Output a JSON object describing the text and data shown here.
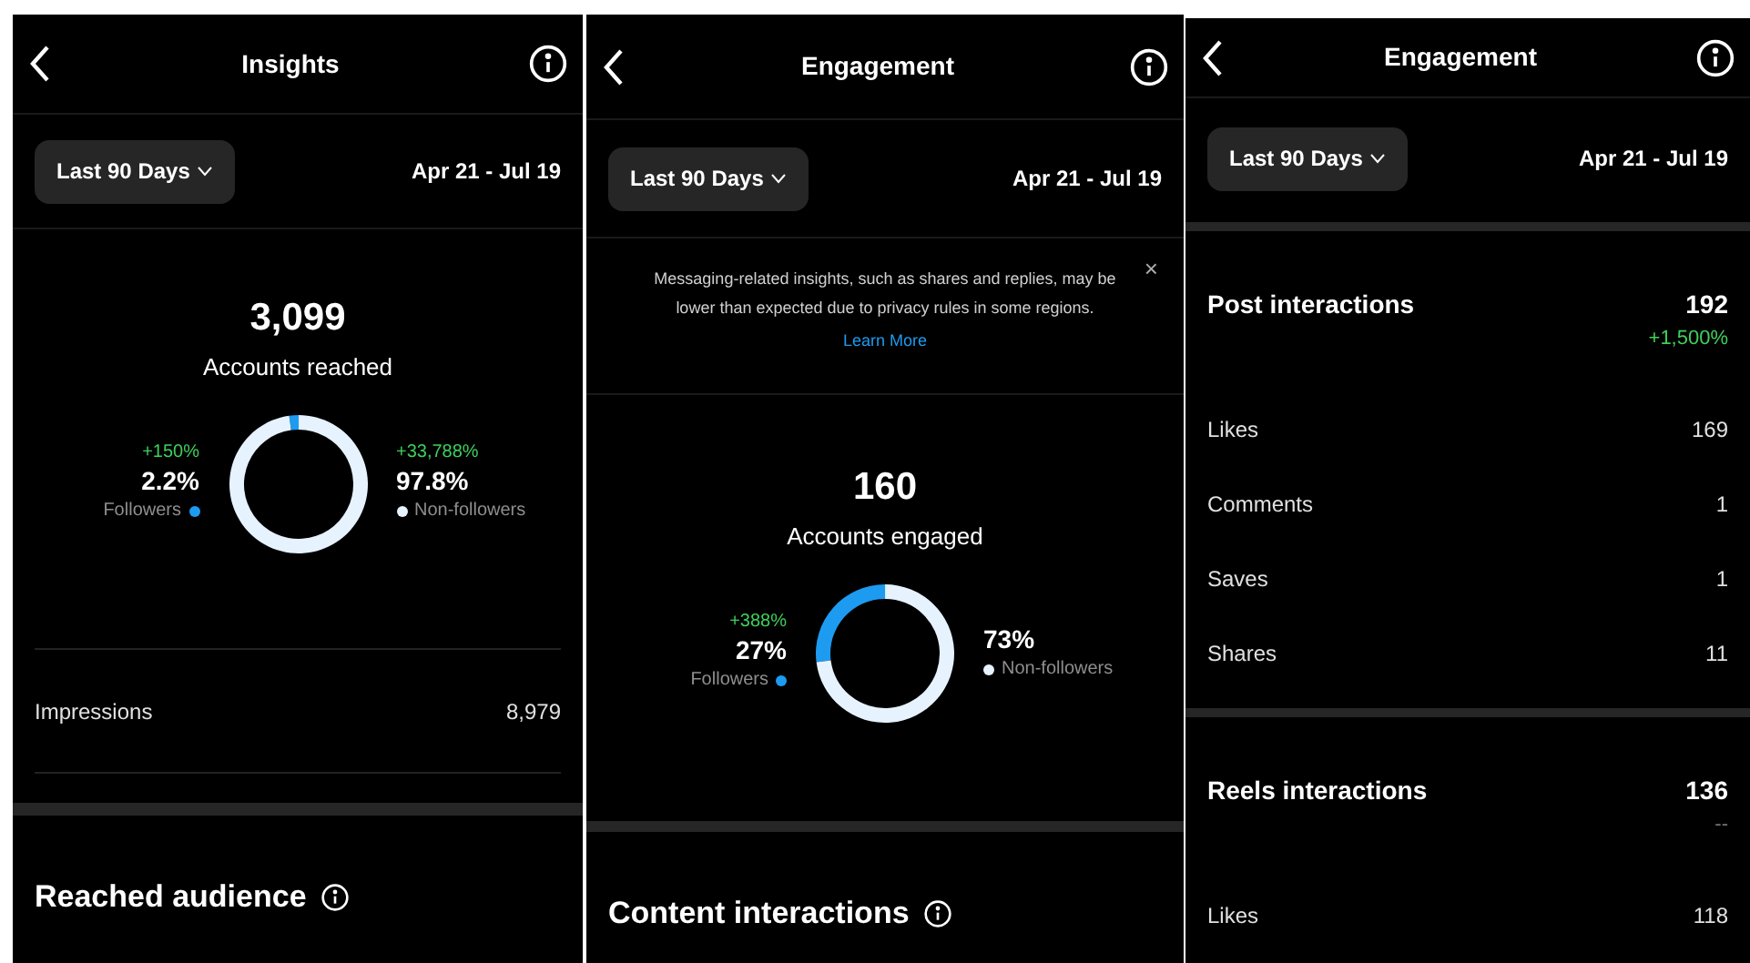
{
  "panels": [
    {
      "kind": "reach",
      "title": "Insights",
      "range": "Last 90 Days",
      "dates": "Apr 21 - Jul 19",
      "metric": {
        "value": "3,099",
        "label": "Accounts reached"
      },
      "left": {
        "change": "+150%",
        "percent": "2.2%",
        "color": "#1d9bf0"
      },
      "right": {
        "change": "+33,788%",
        "percent": "97.8%",
        "color": "#e6f2fd"
      },
      "chart_data": {
        "type": "donut",
        "categories": [
          "Followers",
          "Non-followers"
        ],
        "values": [
          2.2,
          97.8
        ]
      },
      "rows": [
        {
          "label": "Impressions",
          "value": "8,979"
        }
      ],
      "section": "Reached audience"
    },
    {
      "kind": "engaged",
      "title": "Engagement",
      "range": "Last 90 Days",
      "dates": "Apr 21 - Jul 19",
      "notice": {
        "text": "Messaging-related insights, such as shares and replies, may be lower than expected due to privacy rules in some regions.",
        "link": "Learn More",
        "close": "×"
      },
      "metric": {
        "value": "160",
        "label": "Accounts engaged"
      },
      "left": {
        "change": "+388%",
        "percent": "27%",
        "color": "#1d9bf0"
      },
      "right": {
        "percent": "73%",
        "color": "#e6f2fd"
      },
      "chart_data": {
        "type": "donut",
        "categories": [
          "Followers",
          "Non-followers"
        ],
        "values": [
          27,
          73
        ]
      },
      "section": "Content interactions"
    },
    {
      "kind": "interactions",
      "title": "Engagement",
      "range": "Last 90 Days",
      "dates": "Apr 21 - Jul 19",
      "groups": [
        {
          "title": "Post interactions",
          "value": "192",
          "change": "+1,500%",
          "color": "#3ecf5c",
          "rows": [
            {
              "label": "Likes",
              "value": "169"
            },
            {
              "label": "Comments",
              "value": "1"
            },
            {
              "label": "Saves",
              "value": "1"
            },
            {
              "label": "Shares",
              "value": "11"
            }
          ]
        },
        {
          "title": "Reels interactions",
          "value": "136",
          "change": "--",
          "color": "#777777",
          "rows": [
            {
              "label": "Likes",
              "value": "118"
            }
          ]
        }
      ]
    }
  ]
}
